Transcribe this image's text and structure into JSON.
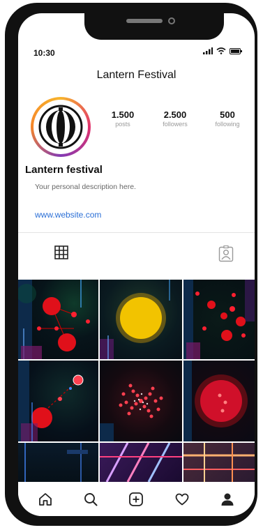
{
  "status_bar": {
    "time": "10:30"
  },
  "header": {
    "title": "Lantern Festival"
  },
  "profile": {
    "stats": [
      {
        "number": "1.500",
        "label": "posts"
      },
      {
        "number": "2.500",
        "label": "followers"
      },
      {
        "number": "500",
        "label": "following"
      }
    ],
    "name": "Lantern festival",
    "description": "Your personal description here.",
    "website": "www.website.com"
  },
  "tabs": [
    {
      "icon": "grid-icon",
      "active": true
    },
    {
      "icon": "tagged-icon",
      "active": false
    }
  ],
  "bottom_nav": [
    "home-icon",
    "search-icon",
    "add-post-icon",
    "heart-icon",
    "profile-icon"
  ],
  "colors": {
    "link": "#2b6fd6",
    "phone_frame": "#111111"
  }
}
